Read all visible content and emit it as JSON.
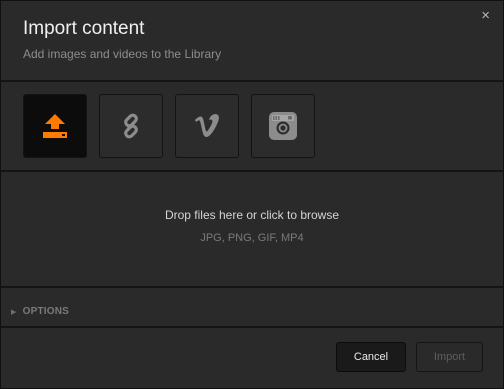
{
  "dialog": {
    "title": "Import content",
    "subtitle": "Add images and videos to the Library",
    "close_label": "×"
  },
  "sources": [
    {
      "name": "upload",
      "icon": "upload-icon",
      "active": true
    },
    {
      "name": "link",
      "icon": "link-icon",
      "active": false
    },
    {
      "name": "vimeo",
      "icon": "vimeo-icon",
      "active": false
    },
    {
      "name": "instagram",
      "icon": "instagram-icon",
      "active": false
    }
  ],
  "dropzone": {
    "main_text": "Drop files here or click to browse",
    "formats": "JPG, PNG, GIF, MP4"
  },
  "options": {
    "label": "OPTIONS",
    "expanded": false
  },
  "footer": {
    "cancel_label": "Cancel",
    "import_label": "Import",
    "import_enabled": false
  },
  "colors": {
    "accent": "#ff7b00",
    "dialog_bg": "#2a2a2a",
    "icon_gray": "#8c8c8c"
  }
}
